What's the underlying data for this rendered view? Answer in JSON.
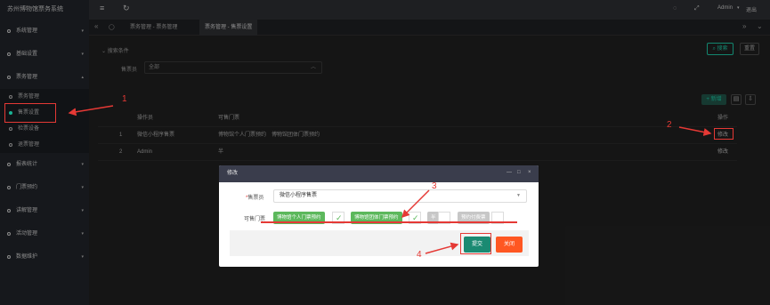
{
  "app": {
    "brand": "苏州博物馆票务系统"
  },
  "sidebar": {
    "items": [
      {
        "label": "系统管理"
      },
      {
        "label": "基础设置"
      },
      {
        "label": "票务管理"
      }
    ],
    "subitems": [
      {
        "label": "票务管理"
      },
      {
        "label": "售票设置"
      },
      {
        "label": "检票设备"
      },
      {
        "label": "退票管理"
      }
    ],
    "more": [
      {
        "label": "报表统计"
      },
      {
        "label": "门票预约"
      },
      {
        "label": "讲解管理"
      },
      {
        "label": "活动管理"
      },
      {
        "label": "数据维护"
      }
    ]
  },
  "topbar": {
    "user": "Admin",
    "exit": "退出"
  },
  "tabs": [
    {
      "label": "票务管理 - 票务管理"
    },
    {
      "label": "票务管理 - 售票设置"
    }
  ],
  "search": {
    "title": "搜索条件",
    "label": "售票员",
    "value": "全部",
    "search_btn": "搜索",
    "reset_btn": "重置"
  },
  "toolbar": {
    "add": "+ 新增"
  },
  "table": {
    "headers": {
      "op": "操作员",
      "gate": "可售门票",
      "action": "操作"
    },
    "rows": [
      {
        "idx": "1",
        "op": "微信小程序售票",
        "gate": "博物馆个人门票预约　博物馆团体门票预约",
        "action": "修改"
      },
      {
        "idx": "2",
        "op": "Admin",
        "gate": "半",
        "action": "修改"
      }
    ]
  },
  "modal": {
    "title": "修改",
    "seller_label": "售票员",
    "seller_required": "*",
    "seller_value": "微信小程序售票",
    "tickets_label": "可售门票",
    "options": [
      {
        "label": "博物馆个人门票预约",
        "checked": true
      },
      {
        "label": "博物馆团体门票预约",
        "checked": true
      },
      {
        "label": "半",
        "checked": false
      },
      {
        "label": "预约付费票",
        "checked": false
      }
    ],
    "submit": "提交",
    "close": "关闭",
    "ctrl_min": "—",
    "ctrl_max": "□",
    "ctrl_close": "×"
  },
  "annotations": [
    "1",
    "2",
    "3",
    "4"
  ],
  "colors": {
    "accent": "#1ab394",
    "annotation": "#e53935",
    "chip_on": "#5cb85c",
    "close_btn": "#ff5722"
  }
}
